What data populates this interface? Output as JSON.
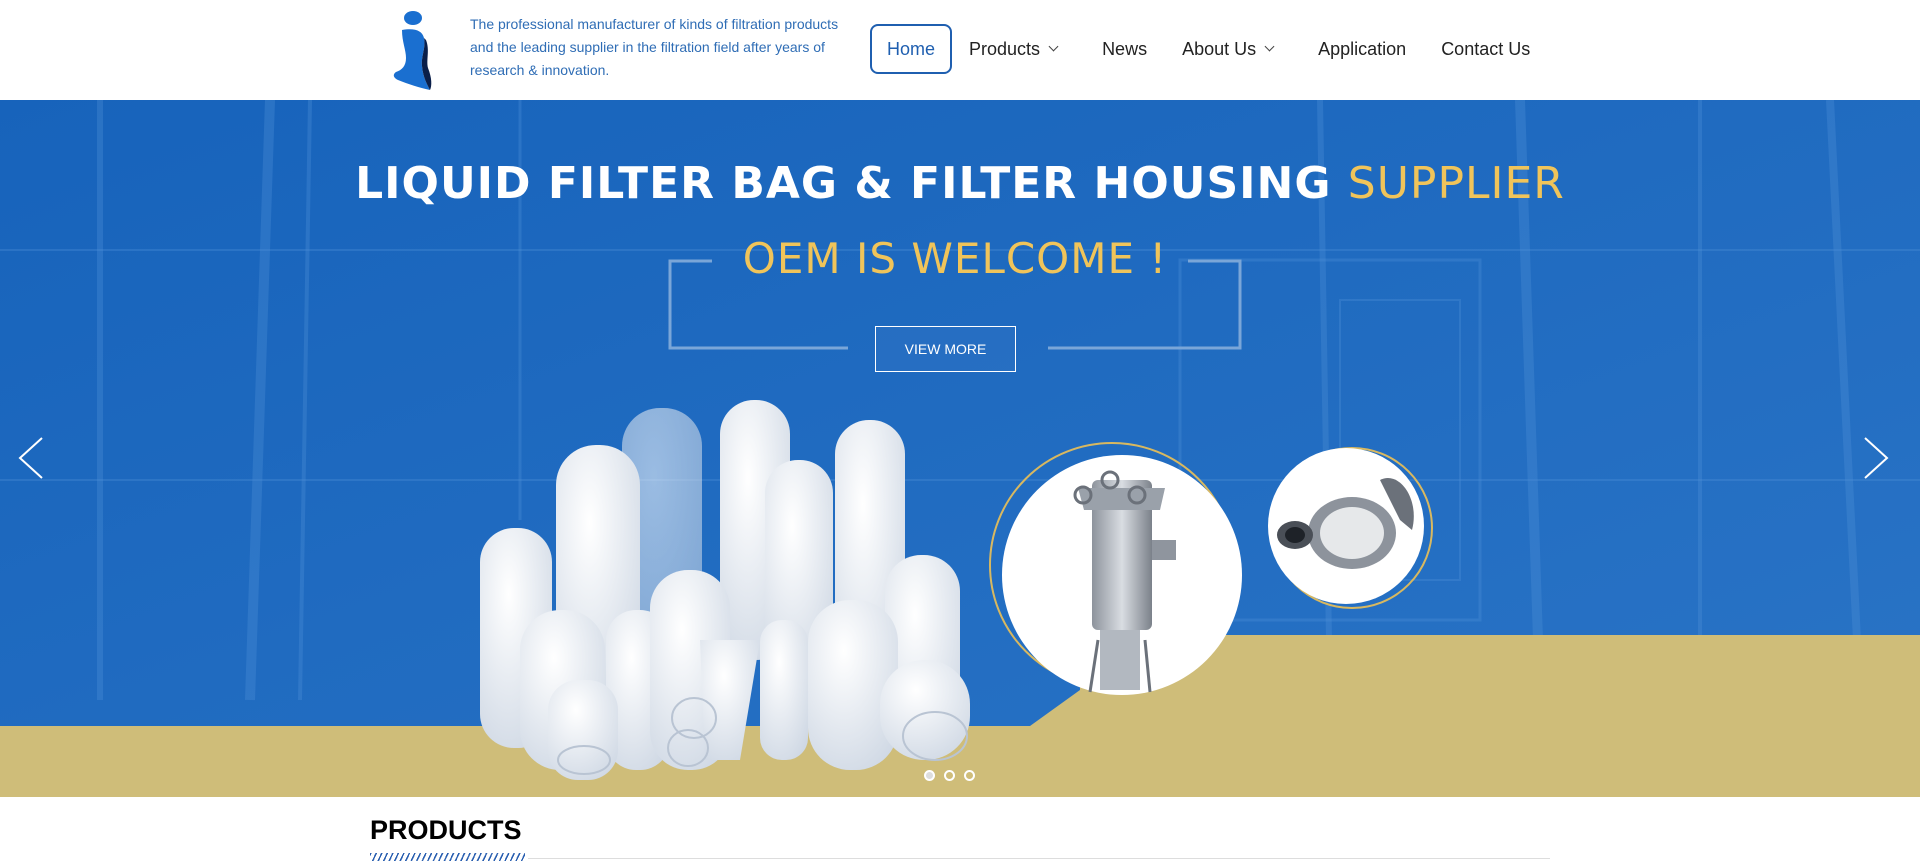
{
  "header": {
    "tagline": "The professional manufacturer of kinds of filtration products and the leading supplier in the filtration field after years of research & innovation.",
    "nav": [
      {
        "label": "Home",
        "active": true,
        "dropdown": false
      },
      {
        "label": "Products",
        "active": false,
        "dropdown": true
      },
      {
        "label": "News",
        "active": false,
        "dropdown": false
      },
      {
        "label": "About Us",
        "active": false,
        "dropdown": true
      },
      {
        "label": "Application",
        "active": false,
        "dropdown": false
      },
      {
        "label": "Contact Us",
        "active": false,
        "dropdown": false
      }
    ]
  },
  "hero": {
    "title_main": "LIQUID FILTER BAG & FILTER HOUSING ",
    "title_accent": "SUPPLIER",
    "subtitle": "OEM IS WELCOME !",
    "button_label": "VIEW MORE",
    "slides_count": 3,
    "active_slide": 1
  },
  "products": {
    "heading": "PRODUCTS"
  },
  "colors": {
    "brand_blue": "#1f5fb0",
    "hero_blue": "#1a63b6",
    "accent_gold": "#f0c45a",
    "sand": "#cfbd79"
  }
}
